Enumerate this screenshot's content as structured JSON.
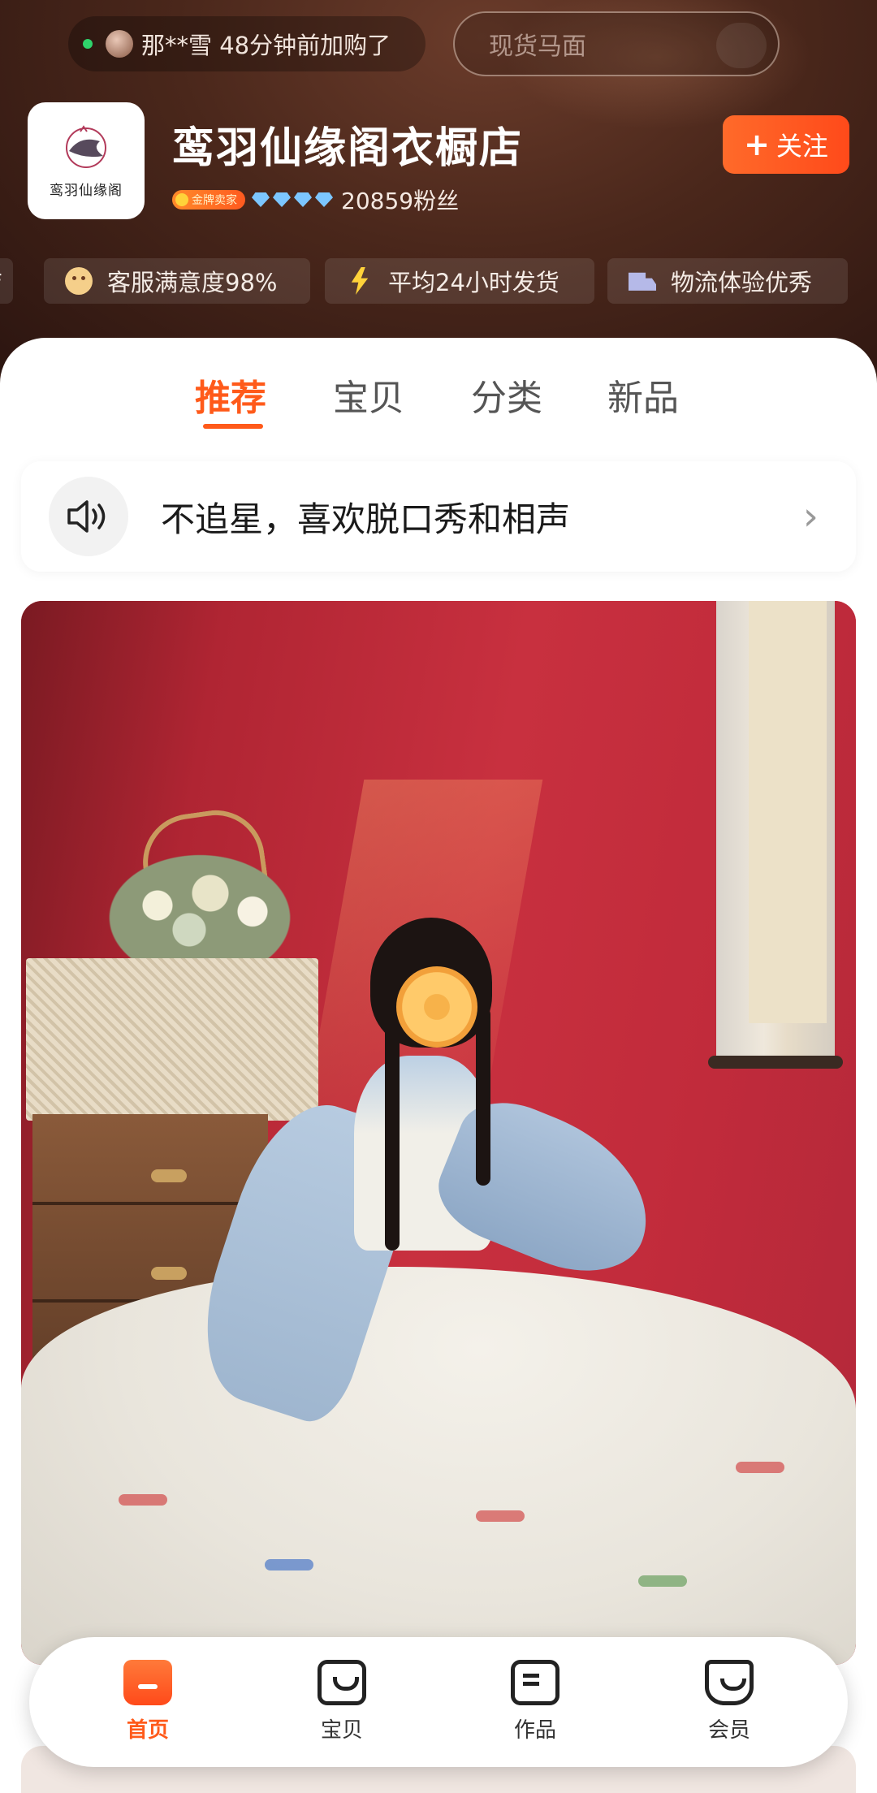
{
  "ticker": {
    "text": "那**雪 48分钟前加购了"
  },
  "search": {
    "placeholder": "现货马面"
  },
  "shop": {
    "name": "鸾羽仙缘阁衣橱店",
    "logo_text": "鸾羽仙缘阁",
    "badge": "金牌卖家",
    "diamond_count": 4,
    "fans": "20859粉丝",
    "follow_label": "关注"
  },
  "services": [
    {
      "label": "店",
      "icon": "store-icon"
    },
    {
      "label": "客服满意度98%",
      "icon": "smile-icon"
    },
    {
      "label": "平均24小时发货",
      "icon": "lightning-icon"
    },
    {
      "label": "物流体验优秀",
      "icon": "truck-icon"
    }
  ],
  "tabs": [
    {
      "label": "推荐",
      "active": true
    },
    {
      "label": "宝贝",
      "active": false
    },
    {
      "label": "分类",
      "active": false
    },
    {
      "label": "新品",
      "active": false
    }
  ],
  "announcement": {
    "text": "不追星，喜欢脱口秀和相声"
  },
  "bottom_nav": [
    {
      "label": "首页",
      "icon": "home-icon",
      "active": true
    },
    {
      "label": "宝贝",
      "icon": "bag-icon",
      "active": false
    },
    {
      "label": "作品",
      "icon": "works-icon",
      "active": false
    },
    {
      "label": "会员",
      "icon": "member-icon",
      "active": false
    }
  ],
  "colors": {
    "accent": "#ff5a1a",
    "header_bg": "#4a271b"
  }
}
